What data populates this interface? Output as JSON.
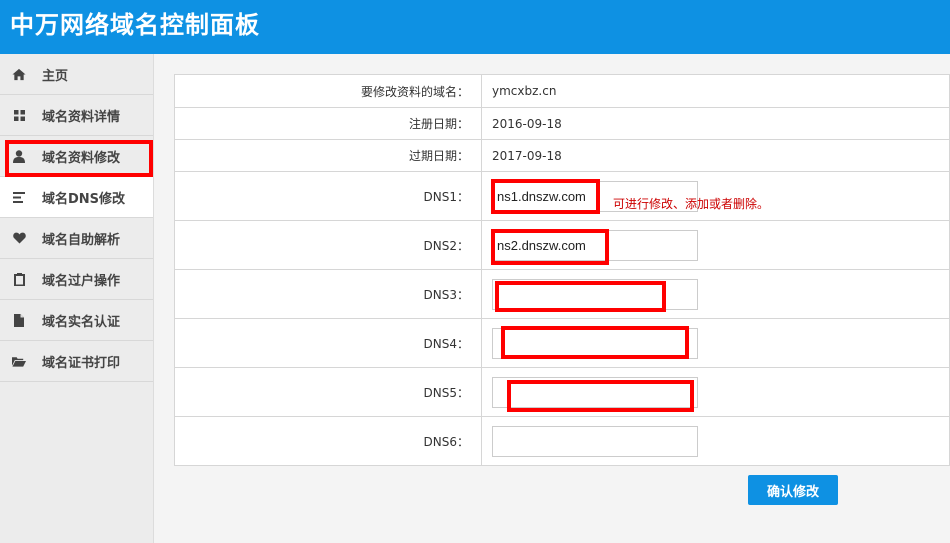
{
  "header": {
    "title": "中万网络域名控制面板"
  },
  "sidebar": {
    "items": [
      {
        "label": "主页",
        "icon": "home-icon"
      },
      {
        "label": "域名资料详情",
        "icon": "grid-icon"
      },
      {
        "label": "域名资料修改",
        "icon": "user-icon"
      },
      {
        "label": "域名DNS修改",
        "icon": "list-icon",
        "active": true
      },
      {
        "label": "域名自助解析",
        "icon": "heart-icon"
      },
      {
        "label": "域名过户操作",
        "icon": "clipboard-icon"
      },
      {
        "label": "域名实名认证",
        "icon": "document-icon"
      },
      {
        "label": "域名证书打印",
        "icon": "folder-open-icon"
      }
    ]
  },
  "form": {
    "domain_label": "要修改资料的域名：",
    "domain_value": "ymcxbz.cn",
    "reg_label": "注册日期：",
    "reg_value": "2016-09-18",
    "exp_label": "过期日期：",
    "exp_value": "2017-09-18",
    "dns": [
      {
        "label": "DNS1：",
        "value": "ns1.dnszw.com"
      },
      {
        "label": "DNS2：",
        "value": "ns2.dnszw.com"
      },
      {
        "label": "DNS3：",
        "value": ""
      },
      {
        "label": "DNS4：",
        "value": ""
      },
      {
        "label": "DNS5：",
        "value": ""
      },
      {
        "label": "DNS6：",
        "value": ""
      }
    ],
    "hint": "可进行修改、添加或者删除。",
    "confirm_label": "确认修改"
  },
  "colors": {
    "header_bg": "#0e91e3",
    "highlight": "#ff0000",
    "hint": "#cc0000"
  }
}
